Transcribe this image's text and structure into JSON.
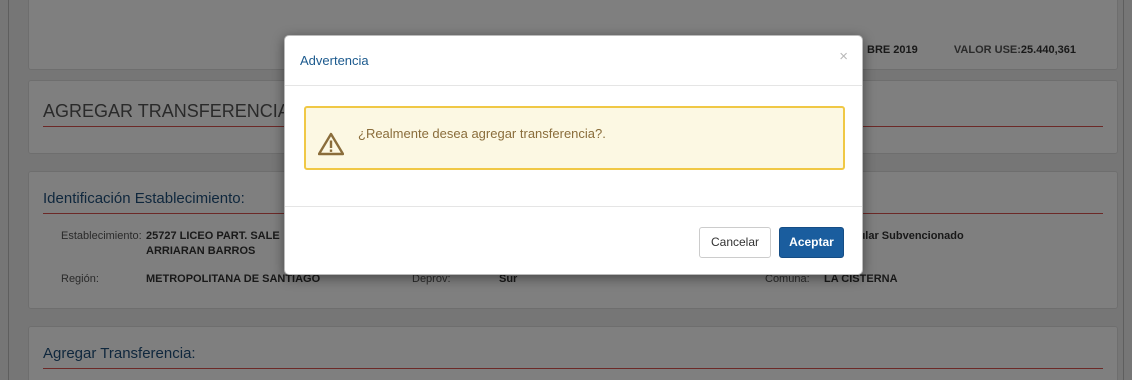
{
  "header_info": {
    "month_fragment": "BRE 2019",
    "valor_use_label": "VALOR USE:",
    "valor_use_value": "25.440,361"
  },
  "agregar_section": {
    "title": "AGREGAR TRANSFERENCIA"
  },
  "identificacion": {
    "title": "Identificación Establecimiento:",
    "establecimiento_label": "Establecimiento:",
    "establecimiento_value_line1": "25727 LICEO PART. SALE",
    "establecimiento_value_line2": "ARRIARAN BARROS",
    "region_label": "Región:",
    "region_value": "METROPOLITANA DE SANTIAGO",
    "deprov_label": "Deprov:",
    "deprov_value": "Sur",
    "dependencia_value": "Particular Subvencionado",
    "comuna_label": "Comuna:",
    "comuna_value": "LA CISTERNA"
  },
  "transferencia_section": {
    "title": "Agregar Transferencia:"
  },
  "modal": {
    "title": "Advertencia",
    "close_glyph": "×",
    "message": "¿Realmente desea agregar transferencia?.",
    "cancel_label": "Cancelar",
    "accept_label": "Aceptar",
    "icon": "warning-triangle-icon",
    "colors": {
      "alert_bg": "#fcf8e3",
      "alert_border": "#f0c845",
      "alert_text": "#8a6d3b",
      "primary": "#1a5d9e"
    }
  }
}
